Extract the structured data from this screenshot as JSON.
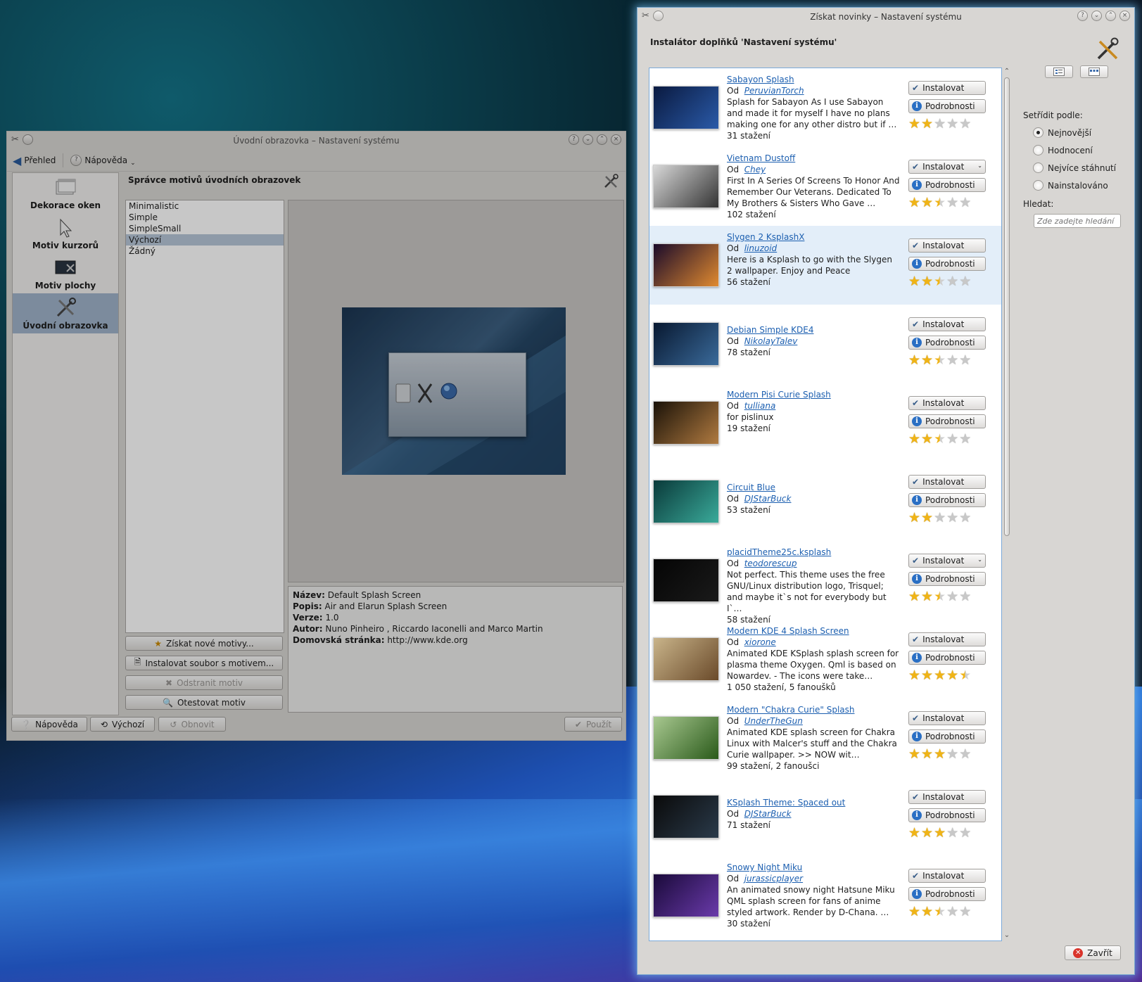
{
  "left_window": {
    "title": "Úvodní obrazovka – Nastavení systému",
    "toolbar": {
      "overview": "Přehled",
      "help": "Nápověda"
    },
    "sidebar": [
      {
        "label": "Dekorace oken",
        "icon": "window-decoration-icon"
      },
      {
        "label": "Motiv kurzorů",
        "icon": "cursor-icon"
      },
      {
        "label": "Motiv plochy",
        "icon": "desktop-theme-icon"
      },
      {
        "label": "Úvodní obrazovka",
        "icon": "splash-tools-icon",
        "selected": true
      }
    ],
    "panel_title": "Správce motivů úvodních obrazovek",
    "themes": [
      "Minimalistic",
      "Simple",
      "SimpleSmall",
      "Výchozí",
      "Žádný"
    ],
    "selected_theme": "Výchozí",
    "info": {
      "name_label": "Název:",
      "name": "Default Splash Screen",
      "desc_label": "Popis:",
      "desc": "Air and Elarun Splash Screen",
      "version_label": "Verze:",
      "version": "1.0",
      "author_label": "Autor:",
      "author": "Nuno Pinheiro , Riccardo Iaconelli and Marco Martin",
      "home_label": "Domovská stránka:",
      "home": "http://www.kde.org"
    },
    "buttons": {
      "get_new": "Získat nové motivy...",
      "install_file": "Instalovat soubor s motivem...",
      "remove": "Odstranit motiv",
      "test": "Otestovat motiv",
      "help": "Nápověda",
      "defaults": "Výchozí",
      "reset": "Obnovit",
      "apply": "Použít"
    }
  },
  "right_window": {
    "title": "Získat novinky – Nastavení systému",
    "header": "Instalátor doplňků 'Nastavení systému'",
    "by_label": "Od",
    "install_label": "Instalovat",
    "details_label": "Podrobnosti",
    "items": [
      {
        "name": "Sabayon Splash",
        "author": "PeruvianTorch",
        "desc": "Splash for Sabayon As I use Sabayon and made it for myself I have no plans making one for any other distro but if …",
        "downloads": "31 stažení",
        "rating": 2,
        "dropdown": false,
        "colors": [
          "#0a1a40",
          "#2a5aa8"
        ]
      },
      {
        "name": "Vietnam Dustoff",
        "author": "Chey",
        "desc": "First In A Series Of Screens To Honor And Remember Our Veterans. Dedicated To My Brothers & Sisters Who Gave …",
        "downloads": "102 stažení",
        "rating": 2.5,
        "dropdown": true,
        "colors": [
          "#d8d8d8",
          "#333333"
        ]
      },
      {
        "name": "Slygen 2 KsplashX",
        "author": "linuzoid",
        "desc": "Here is a Ksplash to go with the Slygen 2 wallpaper. Enjoy and Peace",
        "downloads": "56 stažení",
        "rating": 2.5,
        "dropdown": false,
        "colors": [
          "#1a0a2a",
          "#e08a30"
        ]
      },
      {
        "name": "Debian Simple KDE4",
        "author": "NikolayTalev",
        "desc": "",
        "downloads": "78 stažení",
        "rating": 2.5,
        "dropdown": false,
        "colors": [
          "#081830",
          "#3a6a9a"
        ]
      },
      {
        "name": "Modern Pisi Curie Splash",
        "author": "tulliana",
        "desc": "for pislinux",
        "downloads": "19 stažení",
        "rating": 2.5,
        "dropdown": false,
        "colors": [
          "#1a1208",
          "#b07a40"
        ]
      },
      {
        "name": "Circuit Blue",
        "author": "DJStarBuck",
        "desc": "",
        "downloads": "53 stažení",
        "rating": 2,
        "dropdown": false,
        "colors": [
          "#0a3a3a",
          "#3aaa9a"
        ]
      },
      {
        "name": "placidTheme25c.ksplash",
        "author": "teodorescup",
        "desc": "Not perfect. This theme uses the free GNU/Linux distribution logo, Trisquel; and maybe it`s not for everybody but I`…",
        "downloads": "58 stažení",
        "rating": 2.5,
        "dropdown": true,
        "colors": [
          "#050505",
          "#1a1a1a"
        ]
      },
      {
        "name": "Modern KDE 4 Splash Screen",
        "author": "xiorone",
        "desc": "Animated KDE KSplash splash screen for plasma theme Oxygen. Qml is based on Nowardev. - The icons were take…",
        "downloads": "1 050 stažení, 5 fanoušků",
        "rating": 4.5,
        "dropdown": false,
        "colors": [
          "#c9b48a",
          "#6a4a2a"
        ]
      },
      {
        "name": "Modern \"Chakra Curie\" Splash",
        "author": "UnderTheGun",
        "desc": "Animated KDE splash screen for Chakra Linux with Malcer's stuff and the Chakra Curie wallpaper. >> NOW wit…",
        "downloads": "99 stažení, 2 fanoušci",
        "rating": 3,
        "dropdown": false,
        "colors": [
          "#a8c890",
          "#2a5a1a"
        ]
      },
      {
        "name": "KSplash Theme: Spaced out",
        "author": "DJStarBuck",
        "desc": "",
        "downloads": "71 stažení",
        "rating": 3,
        "dropdown": false,
        "colors": [
          "#0a0a0a",
          "#2a3a4a"
        ]
      },
      {
        "name": "Snowy Night Miku",
        "author": "jurassicplayer",
        "desc": "An animated snowy night Hatsune Miku QML splash screen for fans of anime styled artwork. Render by D-Chana. …",
        "downloads": "30 stažení",
        "rating": 2.5,
        "dropdown": false,
        "colors": [
          "#1a0a3a",
          "#6a3aaa"
        ]
      }
    ],
    "sort_label": "Setřídit podle:",
    "sort_options": [
      "Nejnovější",
      "Hodnocení",
      "Nejvíce stáhnutí",
      "Nainstalováno"
    ],
    "sort_selected": 0,
    "search_label": "Hledat:",
    "search_placeholder": "Zde zadejte hledání",
    "close_label": "Zavřít"
  }
}
